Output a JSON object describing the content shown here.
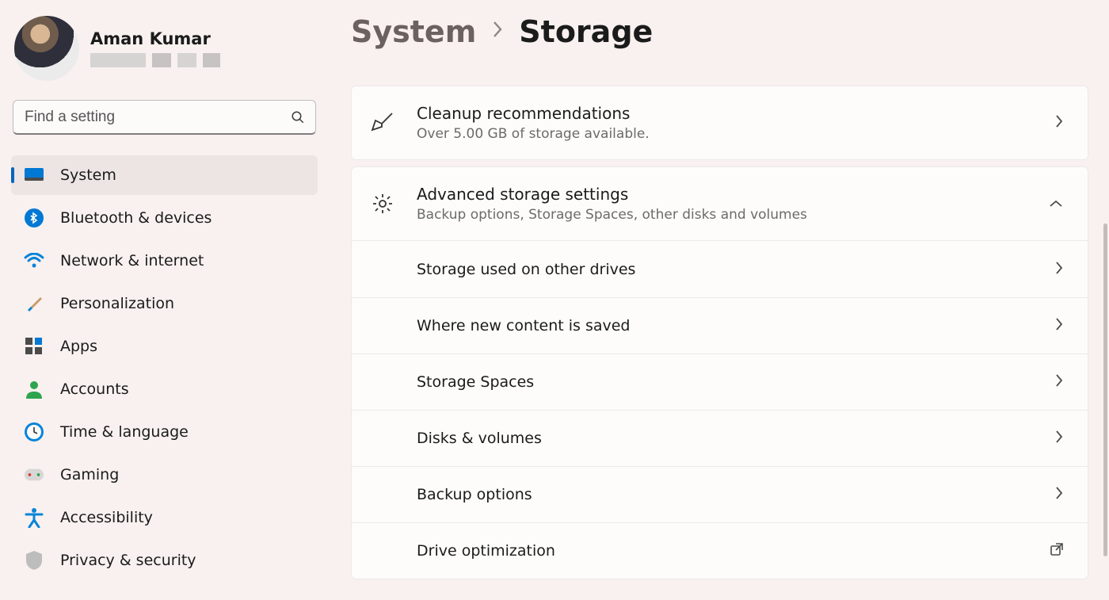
{
  "user": {
    "name": "Aman Kumar"
  },
  "search": {
    "placeholder": "Find a setting"
  },
  "sidebar": {
    "items": [
      {
        "label": "System",
        "active": true,
        "icon": "display"
      },
      {
        "label": "Bluetooth & devices",
        "active": false,
        "icon": "bluetooth"
      },
      {
        "label": "Network & internet",
        "active": false,
        "icon": "wifi"
      },
      {
        "label": "Personalization",
        "active": false,
        "icon": "brush"
      },
      {
        "label": "Apps",
        "active": false,
        "icon": "apps"
      },
      {
        "label": "Accounts",
        "active": false,
        "icon": "person"
      },
      {
        "label": "Time & language",
        "active": false,
        "icon": "clock"
      },
      {
        "label": "Gaming",
        "active": false,
        "icon": "gamepad"
      },
      {
        "label": "Accessibility",
        "active": false,
        "icon": "accessibility"
      },
      {
        "label": "Privacy & security",
        "active": false,
        "icon": "shield"
      }
    ]
  },
  "breadcrumb": {
    "parent": "System",
    "current": "Storage"
  },
  "card_cleanup": {
    "title": "Cleanup recommendations",
    "subtitle": "Over 5.00 GB of storage available."
  },
  "card_advanced": {
    "title": "Advanced storage settings",
    "subtitle": "Backup options, Storage Spaces, other disks and volumes",
    "expanded": true,
    "items": [
      {
        "label": "Storage used on other drives",
        "action": "chevron"
      },
      {
        "label": "Where new content is saved",
        "action": "chevron"
      },
      {
        "label": "Storage Spaces",
        "action": "chevron"
      },
      {
        "label": "Disks & volumes",
        "action": "chevron"
      },
      {
        "label": "Backup options",
        "action": "chevron"
      },
      {
        "label": "Drive optimization",
        "action": "external"
      }
    ]
  }
}
